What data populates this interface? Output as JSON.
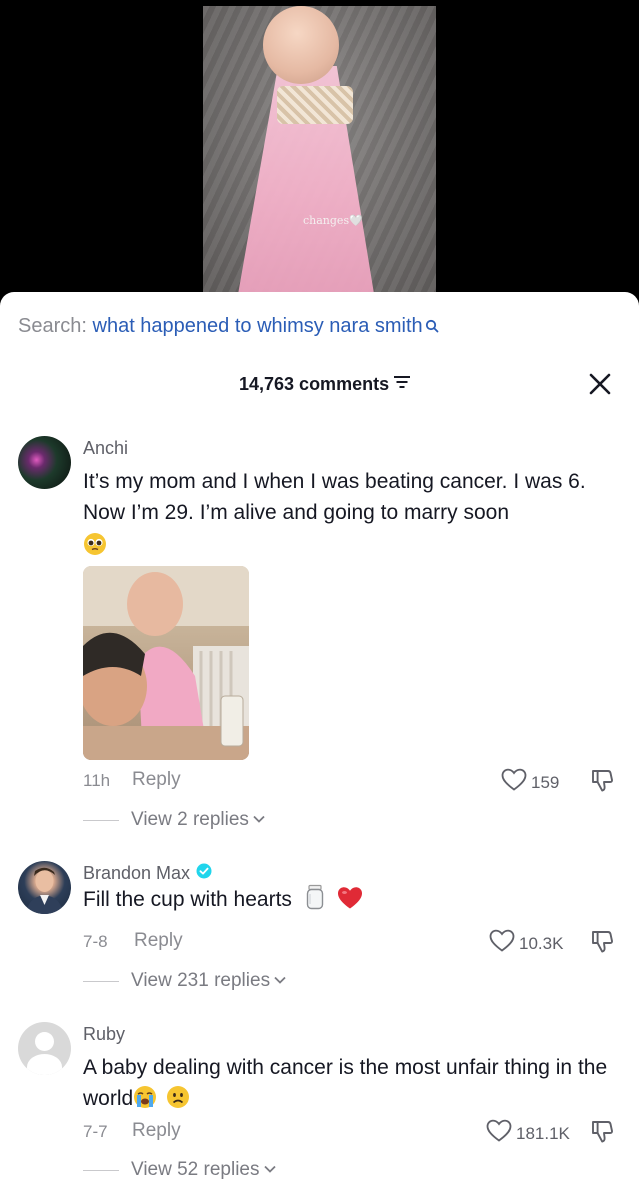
{
  "video": {
    "watermark": "changes🤍"
  },
  "search": {
    "prefix": "Search:",
    "term": "what happened to whimsy nara smith"
  },
  "header": {
    "comment_count": "14,763 comments"
  },
  "comments": [
    {
      "username": "Anchi",
      "text": "It’s my mom and I when I was beating cancer. I was 6. Now I’m 29. I’m alive and going to marry soon",
      "emoji": [
        "pleading-face-emoji"
      ],
      "time": "11h",
      "reply_label": "Reply",
      "likes": "159",
      "view_replies": "View 2 replies",
      "has_photo": true
    },
    {
      "username": "Brandon Max",
      "verified": true,
      "text": "Fill the cup with hearts",
      "emoji": [
        "jar-emoji",
        "red-heart-emoji"
      ],
      "time": "7-8",
      "reply_label": "Reply",
      "likes": "10.3K",
      "view_replies": "View 231 replies"
    },
    {
      "username": "Ruby",
      "text": "A baby dealing with cancer is the most unfair thing in the world",
      "emoji": [
        "loudly-crying-face-emoji",
        "frowning-face-emoji"
      ],
      "time": "7-7",
      "reply_label": "Reply",
      "likes": "181.1K",
      "view_replies": "View 52 replies"
    }
  ],
  "colors": {
    "search_term": "#2b5db6",
    "verified": "#20d5ec",
    "heart": "#e02a36",
    "sheet_bg": "#ffffff"
  }
}
